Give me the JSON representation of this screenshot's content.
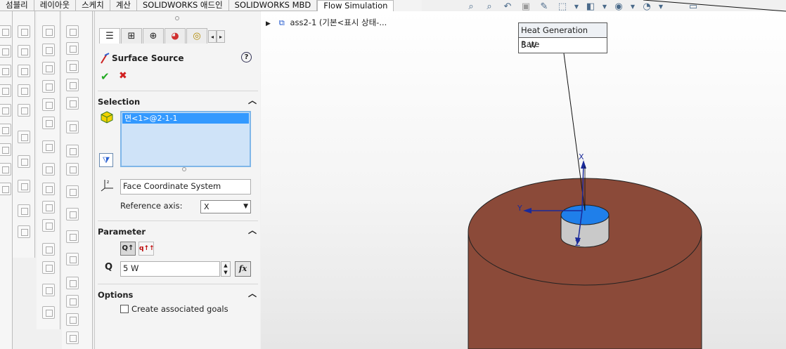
{
  "menu_tabs": [
    "섬블리",
    "레이아웃",
    "스케치",
    "계산",
    "SOLIDWORKS 애드인",
    "SOLIDWORKS MBD",
    "Flow Simulation"
  ],
  "active_tab_index": 6,
  "panel": {
    "title": "Surface Source",
    "help": "?",
    "ok": "✔",
    "cancel": "✖",
    "tab_arrows": [
      "◂",
      "▸"
    ],
    "selection": {
      "header": "Selection",
      "items": [
        "면<1>@2-1-1"
      ],
      "coord_system": "Face Coordinate System",
      "ref_axis_label": "Reference axis:",
      "ref_axis_value": "X"
    },
    "parameter": {
      "header": "Parameter",
      "q_label": "Q",
      "q_value": "5 W",
      "fx_label": "fx"
    },
    "options": {
      "header": "Options",
      "create_goals_label": "Create associated goals",
      "create_goals_checked": false
    }
  },
  "tree": {
    "label": "ass2-1 (기본<표시 상태-..."
  },
  "callout": {
    "header": "Heat Generation Rate",
    "value": "5 W"
  },
  "axes": {
    "x": "X",
    "y": "Y",
    "z": "Z"
  },
  "colors": {
    "cylinder": "#8b4a39",
    "face_highlight": "#1f7fea",
    "axis": "#1a2a9a",
    "selection_bg": "#3399ff"
  }
}
